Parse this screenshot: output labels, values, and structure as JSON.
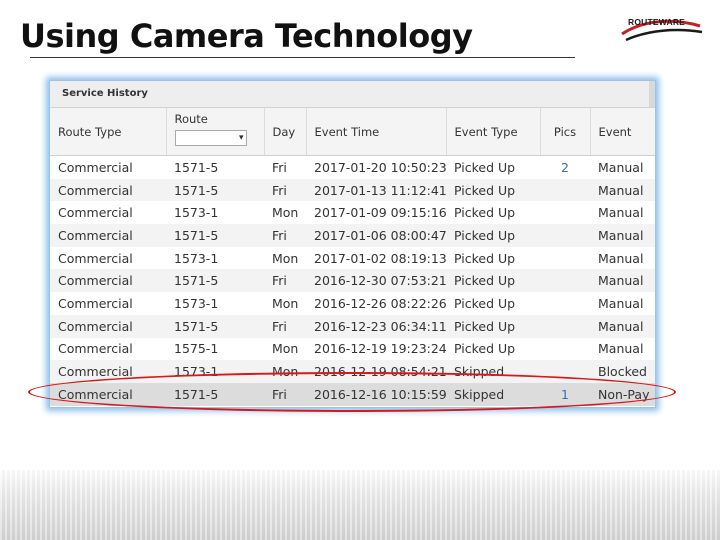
{
  "slide": {
    "title": "Using Camera Technology",
    "logo_text": "ROUTEWARE"
  },
  "panel": {
    "title": "Service History",
    "columns": [
      "Route Type",
      "Route",
      "Day",
      "Event Time",
      "Event Type",
      "Pics",
      "Event"
    ],
    "route_filter_value": "",
    "rows": [
      {
        "route_type": "Commercial",
        "route": "1571-5",
        "day": "Fri",
        "event_time": "2017-01-20 10:50:23",
        "event_type": "Picked Up",
        "pics": "2",
        "event": "Manual"
      },
      {
        "route_type": "Commercial",
        "route": "1571-5",
        "day": "Fri",
        "event_time": "2017-01-13 11:12:41",
        "event_type": "Picked Up",
        "pics": "",
        "event": "Manual"
      },
      {
        "route_type": "Commercial",
        "route": "1573-1",
        "day": "Mon",
        "event_time": "2017-01-09 09:15:16",
        "event_type": "Picked Up",
        "pics": "",
        "event": "Manual"
      },
      {
        "route_type": "Commercial",
        "route": "1571-5",
        "day": "Fri",
        "event_time": "2017-01-06 08:00:47",
        "event_type": "Picked Up",
        "pics": "",
        "event": "Manual"
      },
      {
        "route_type": "Commercial",
        "route": "1573-1",
        "day": "Mon",
        "event_time": "2017-01-02 08:19:13",
        "event_type": "Picked Up",
        "pics": "",
        "event": "Manual"
      },
      {
        "route_type": "Commercial",
        "route": "1571-5",
        "day": "Fri",
        "event_time": "2016-12-30 07:53:21",
        "event_type": "Picked Up",
        "pics": "",
        "event": "Manual"
      },
      {
        "route_type": "Commercial",
        "route": "1573-1",
        "day": "Mon",
        "event_time": "2016-12-26 08:22:26",
        "event_type": "Picked Up",
        "pics": "",
        "event": "Manual"
      },
      {
        "route_type": "Commercial",
        "route": "1571-5",
        "day": "Fri",
        "event_time": "2016-12-23 06:34:11",
        "event_type": "Picked Up",
        "pics": "",
        "event": "Manual"
      },
      {
        "route_type": "Commercial",
        "route": "1575-1",
        "day": "Mon",
        "event_time": "2016-12-19 19:23:24",
        "event_type": "Picked Up",
        "pics": "",
        "event": "Manual"
      },
      {
        "route_type": "Commercial",
        "route": "1573-1",
        "day": "Mon",
        "event_time": "2016-12-19 08:54:21",
        "event_type": "Skipped",
        "pics": "",
        "event": "Blocked"
      },
      {
        "route_type": "Commercial",
        "route": "1571-5",
        "day": "Fri",
        "event_time": "2016-12-16 10:15:59",
        "event_type": "Skipped",
        "pics": "1",
        "event": "Non-Pay"
      }
    ]
  },
  "colors": {
    "highlight_ellipse": "#d7191c",
    "pics_link": "#3b6fb5",
    "panel_glow": "#8ec0ea"
  }
}
